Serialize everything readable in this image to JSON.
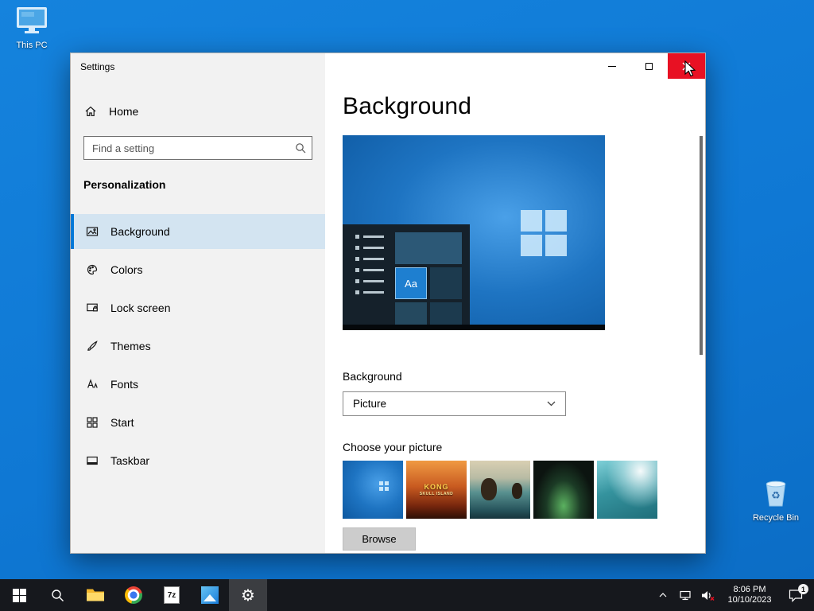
{
  "desktop": {
    "this_pc_label": "This PC",
    "recycle_bin_label": "Recycle Bin"
  },
  "window": {
    "title": "Settings",
    "sidebar": {
      "home_label": "Home",
      "search_placeholder": "Find a setting",
      "section_title": "Personalization",
      "items": [
        {
          "label": "Background",
          "selected": true
        },
        {
          "label": "Colors",
          "selected": false
        },
        {
          "label": "Lock screen",
          "selected": false
        },
        {
          "label": "Themes",
          "selected": false
        },
        {
          "label": "Fonts",
          "selected": false
        },
        {
          "label": "Start",
          "selected": false
        },
        {
          "label": "Taskbar",
          "selected": false
        }
      ]
    },
    "main": {
      "page_title": "Background",
      "preview": {
        "tile_label": "Aa"
      },
      "background_section_label": "Background",
      "background_type_value": "Picture",
      "choose_picture_label": "Choose your picture",
      "browse_button_label": "Browse",
      "thumbnails": [
        {
          "name": "windows-default"
        },
        {
          "name": "kong-skull-island",
          "text_line1": "KONG",
          "text_line2": "SKULL ISLAND"
        },
        {
          "name": "beach-rocks"
        },
        {
          "name": "night-aurora"
        },
        {
          "name": "ocean-swimmer"
        }
      ]
    }
  },
  "taskbar": {
    "clock": {
      "time": "8:06 PM",
      "date": "10/10/2023"
    },
    "notification_badge": "1",
    "seven_zip_label": "7z"
  },
  "glyphs": {
    "gear": "⚙",
    "recycle": "♻"
  },
  "colors": {
    "accent": "#0078d7",
    "close_button": "#e81123",
    "desktop_background": "#0f78d4",
    "taskbar_background": "#16181d"
  }
}
